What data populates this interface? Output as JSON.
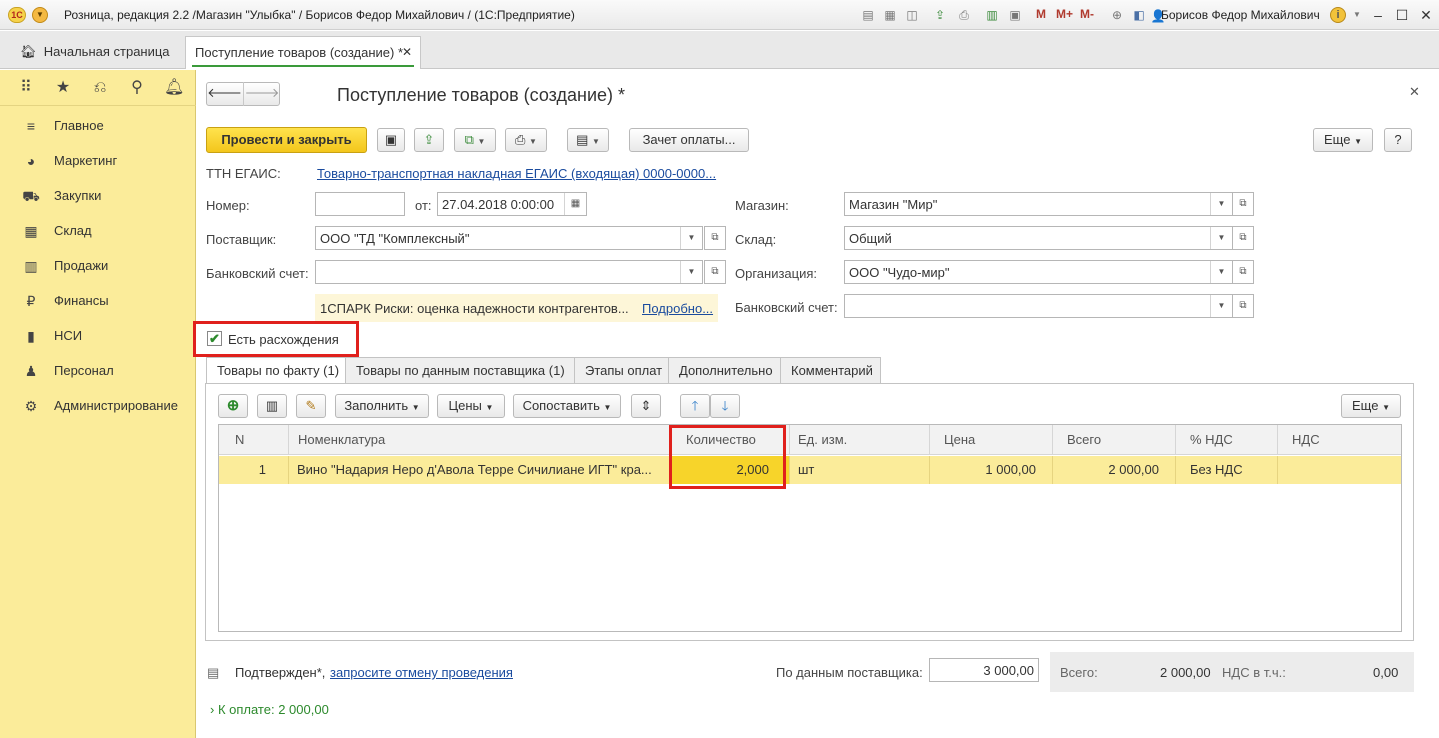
{
  "window": {
    "title": "Розница, редакция 2.2 /Магазин \"Улыбка\" / Борисов Федор Михайлович / (1С:Предприятие)",
    "user": "Борисов Федор Михайлович",
    "logo": "1С",
    "m_buttons": [
      "M",
      "M+",
      "M-"
    ]
  },
  "tabs": {
    "home": "Начальная страница",
    "doc": "Поступление товаров (создание) *"
  },
  "sidebar": {
    "items": [
      {
        "label": "Главное",
        "icon": "menu-icon"
      },
      {
        "label": "Маркетинг",
        "icon": "pie-chart-icon"
      },
      {
        "label": "Закупки",
        "icon": "cart-icon"
      },
      {
        "label": "Склад",
        "icon": "warehouse-icon"
      },
      {
        "label": "Продажи",
        "icon": "basket-icon"
      },
      {
        "label": "Финансы",
        "icon": "ruble-icon"
      },
      {
        "label": "НСИ",
        "icon": "book-icon"
      },
      {
        "label": "Персонал",
        "icon": "person-icon"
      },
      {
        "label": "Администрирование",
        "icon": "gear-icon"
      }
    ]
  },
  "form": {
    "title": "Поступление товаров (создание) *",
    "toolbar": {
      "post_close": "Провести и закрыть",
      "payment_offset": "Зачет оплаты...",
      "more": "Еще",
      "help": "?"
    },
    "egais_label": "ТТН ЕГАИС:",
    "egais_link": "Товарно-транспортная накладная ЕГАИС (входящая) 0000-0000...",
    "number_label": "Номер:",
    "number_value": "",
    "date_label": "от:",
    "date_value": "27.04.2018  0:00:00",
    "supplier_label": "Поставщик:",
    "supplier_value": "ООО \"ТД \"Комплексный\"",
    "bank_label": "Банковский счет:",
    "bank_value": "",
    "spark_text": "1СПАРК Риски: оценка надежности контрагентов...",
    "spark_link": "Подробно...",
    "store_label": "Магазин:",
    "store_value": "Магазин \"Мир\"",
    "warehouse_label": "Склад:",
    "warehouse_value": "Общий",
    "org_label": "Организация:",
    "org_value": "ООО \"Чудо-мир\"",
    "org_bank_label": "Банковский счет:",
    "org_bank_value": "",
    "discrepancy_label": "Есть расхождения",
    "discrepancy_checked": true
  },
  "doc_tabs": [
    "Товары по факту (1)",
    "Товары по данным поставщика (1)",
    "Этапы оплат",
    "Дополнительно",
    "Комментарий"
  ],
  "table_toolbar": {
    "fill": "Заполнить",
    "prices": "Цены",
    "match": "Сопоставить",
    "more": "Еще"
  },
  "table": {
    "columns": [
      "N",
      "Номенклатура",
      "Количество",
      "Ед. изм.",
      "Цена",
      "Всего",
      "% НДС",
      "НДС"
    ],
    "rows": [
      {
        "n": "1",
        "item": "Вино \"Надария Неро д'Авола Терре Сичилиане ИГТ\" кра...",
        "qty": "2,000",
        "unit": "шт",
        "price": "1 000,00",
        "total": "2 000,00",
        "vat_rate": "Без НДС",
        "vat": ""
      }
    ]
  },
  "footer": {
    "status": "Подтвержден*,",
    "cancel_link": "запросите отмену проведения",
    "supplier_data_label": "По данным поставщика:",
    "supplier_data_value": "3 000,00",
    "total_label": "Всего:",
    "total_value": "2 000,00",
    "vat_label": "НДС в т.ч.:",
    "vat_value": "0,00",
    "to_pay": "К оплате: 2 000,00"
  },
  "colors": {
    "accent_yellow": "#fbec9a",
    "primary_button": "#f3c61c",
    "highlight_red": "#e0201c",
    "link_blue": "#1a4b9e"
  }
}
